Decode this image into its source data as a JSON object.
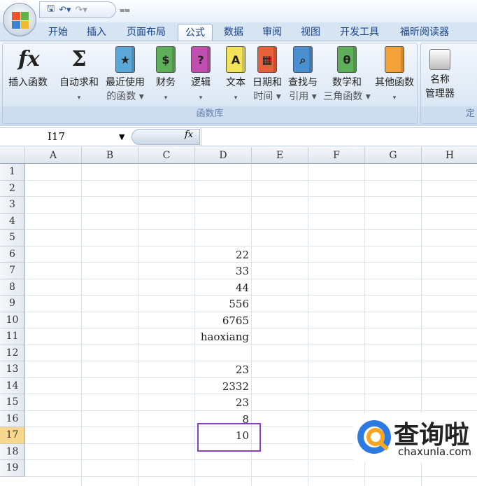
{
  "app": {
    "quick_access": [
      "save-icon",
      "undo-icon",
      "redo-icon",
      "customize-icon"
    ]
  },
  "tabs": [
    "开始",
    "插入",
    "页面布局",
    "公式",
    "数据",
    "审阅",
    "视图",
    "开发工具",
    "福昕阅读器"
  ],
  "active_tab": "公式",
  "ribbon": {
    "group_label": "函数库",
    "group2_label": "定",
    "buttons": [
      {
        "l1": "插入函数",
        "l2": "",
        "icon": "fx",
        "color": "#ffffff"
      },
      {
        "l1": "自动求和",
        "l2": "▾",
        "icon": "Σ",
        "color": "#ffffff"
      },
      {
        "l1": "最近使用",
        "l2": "的函数 ▾",
        "icon": "★",
        "color": "#5ba8d8"
      },
      {
        "l1": "财务",
        "l2": "▾",
        "icon": "$",
        "color": "#5fae5a"
      },
      {
        "l1": "逻辑",
        "l2": "▾",
        "icon": "?",
        "color": "#c04fb0"
      },
      {
        "l1": "文本",
        "l2": "▾",
        "icon": "A",
        "color": "#f2e35a"
      },
      {
        "l1": "日期和",
        "l2": "时间 ▾",
        "icon": "▦",
        "color": "#e8603a"
      },
      {
        "l1": "查找与",
        "l2": "引用 ▾",
        "icon": "⌕",
        "color": "#4a8fd0"
      },
      {
        "l1": "数学和",
        "l2": "三角函数 ▾",
        "icon": "θ",
        "color": "#5fae5a"
      },
      {
        "l1": "其他函数",
        "l2": "▾",
        "icon": "",
        "color": "#f4a13a"
      }
    ],
    "name_manager": {
      "l1": "名称",
      "l2": "管理器"
    }
  },
  "formula_bar": {
    "name_box": "I17",
    "fx": "fx",
    "formula": ""
  },
  "columns": [
    "A",
    "B",
    "C",
    "D",
    "E",
    "F",
    "G",
    "H"
  ],
  "rows": [
    "1",
    "2",
    "3",
    "4",
    "5",
    "6",
    "7",
    "8",
    "9",
    "10",
    "11",
    "12",
    "13",
    "14",
    "15",
    "16",
    "17",
    "18",
    "19"
  ],
  "selected_row": "17",
  "column_d": {
    "6": "22",
    "7": "33",
    "8": "44",
    "9": "556",
    "10": "6765",
    "11": "haoxiang",
    "13": "23",
    "14": "2332",
    "15": "23",
    "16": "8",
    "17": "10"
  },
  "watermark": {
    "brand": "查询啦",
    "url": "chaxunla.com"
  },
  "colors": {
    "selection": "#8a3fc4",
    "selected_row_header": "#f8d88e"
  }
}
